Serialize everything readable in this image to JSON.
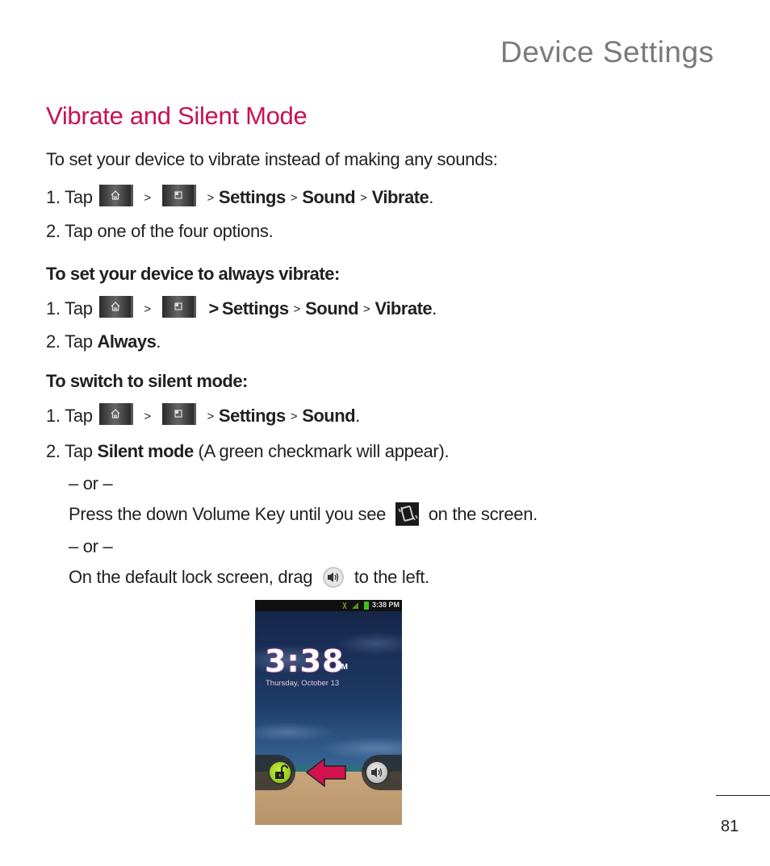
{
  "header": {
    "chapter_title": "Device Settings"
  },
  "section": {
    "heading": "Vibrate and Silent Mode",
    "intro": "To set your device to vibrate instead of making any sounds:",
    "vibrate_steps": {
      "step1_prefix": "1. Tap",
      "sep": ">",
      "path": [
        "Settings",
        "Sound",
        "Vibrate"
      ],
      "end": ".",
      "step2": "2. Tap one of the four options."
    },
    "always_vibrate": {
      "heading": "To set your device to always vibrate:",
      "step1_prefix": "1. Tap",
      "sep": ">",
      "path": [
        "Settings",
        "Sound",
        "Vibrate"
      ],
      "end": ".",
      "step2_prefix": "2. Tap",
      "step2_bold": "Always",
      "step2_end": "."
    },
    "silent_mode": {
      "heading": "To switch to silent mode:",
      "step1_prefix": "1. Tap",
      "sep": ">",
      "path": [
        "Settings",
        "Sound"
      ],
      "end": ".",
      "step2_prefix": "2. Tap",
      "step2_bold": "Silent mode",
      "step2_rest": " (A green checkmark will appear).",
      "or1": "– or –",
      "alt1_before": "Press the down Volume Key until you see",
      "alt1_after": "on the screen.",
      "or2": "– or –",
      "alt2_before": "On the default lock screen, drag",
      "alt2_after": "to the left."
    }
  },
  "icons": {
    "home_key": "home-icon",
    "menu_key": "menu-icon",
    "vibrate_indicator": "vibrate-icon",
    "sound_slider": "speaker-icon"
  },
  "phone_screen": {
    "status_time": "3:38 PM",
    "clock_time": "3:38",
    "clock_ampm": "PM",
    "date": "Thursday, October 13"
  },
  "colors": {
    "heading_accent": "#c8124f",
    "chapter_title": "#7a7a7a",
    "arrow": "#d1124e",
    "unlock_green": "#9ad21e"
  },
  "footer": {
    "page_number": "81"
  }
}
